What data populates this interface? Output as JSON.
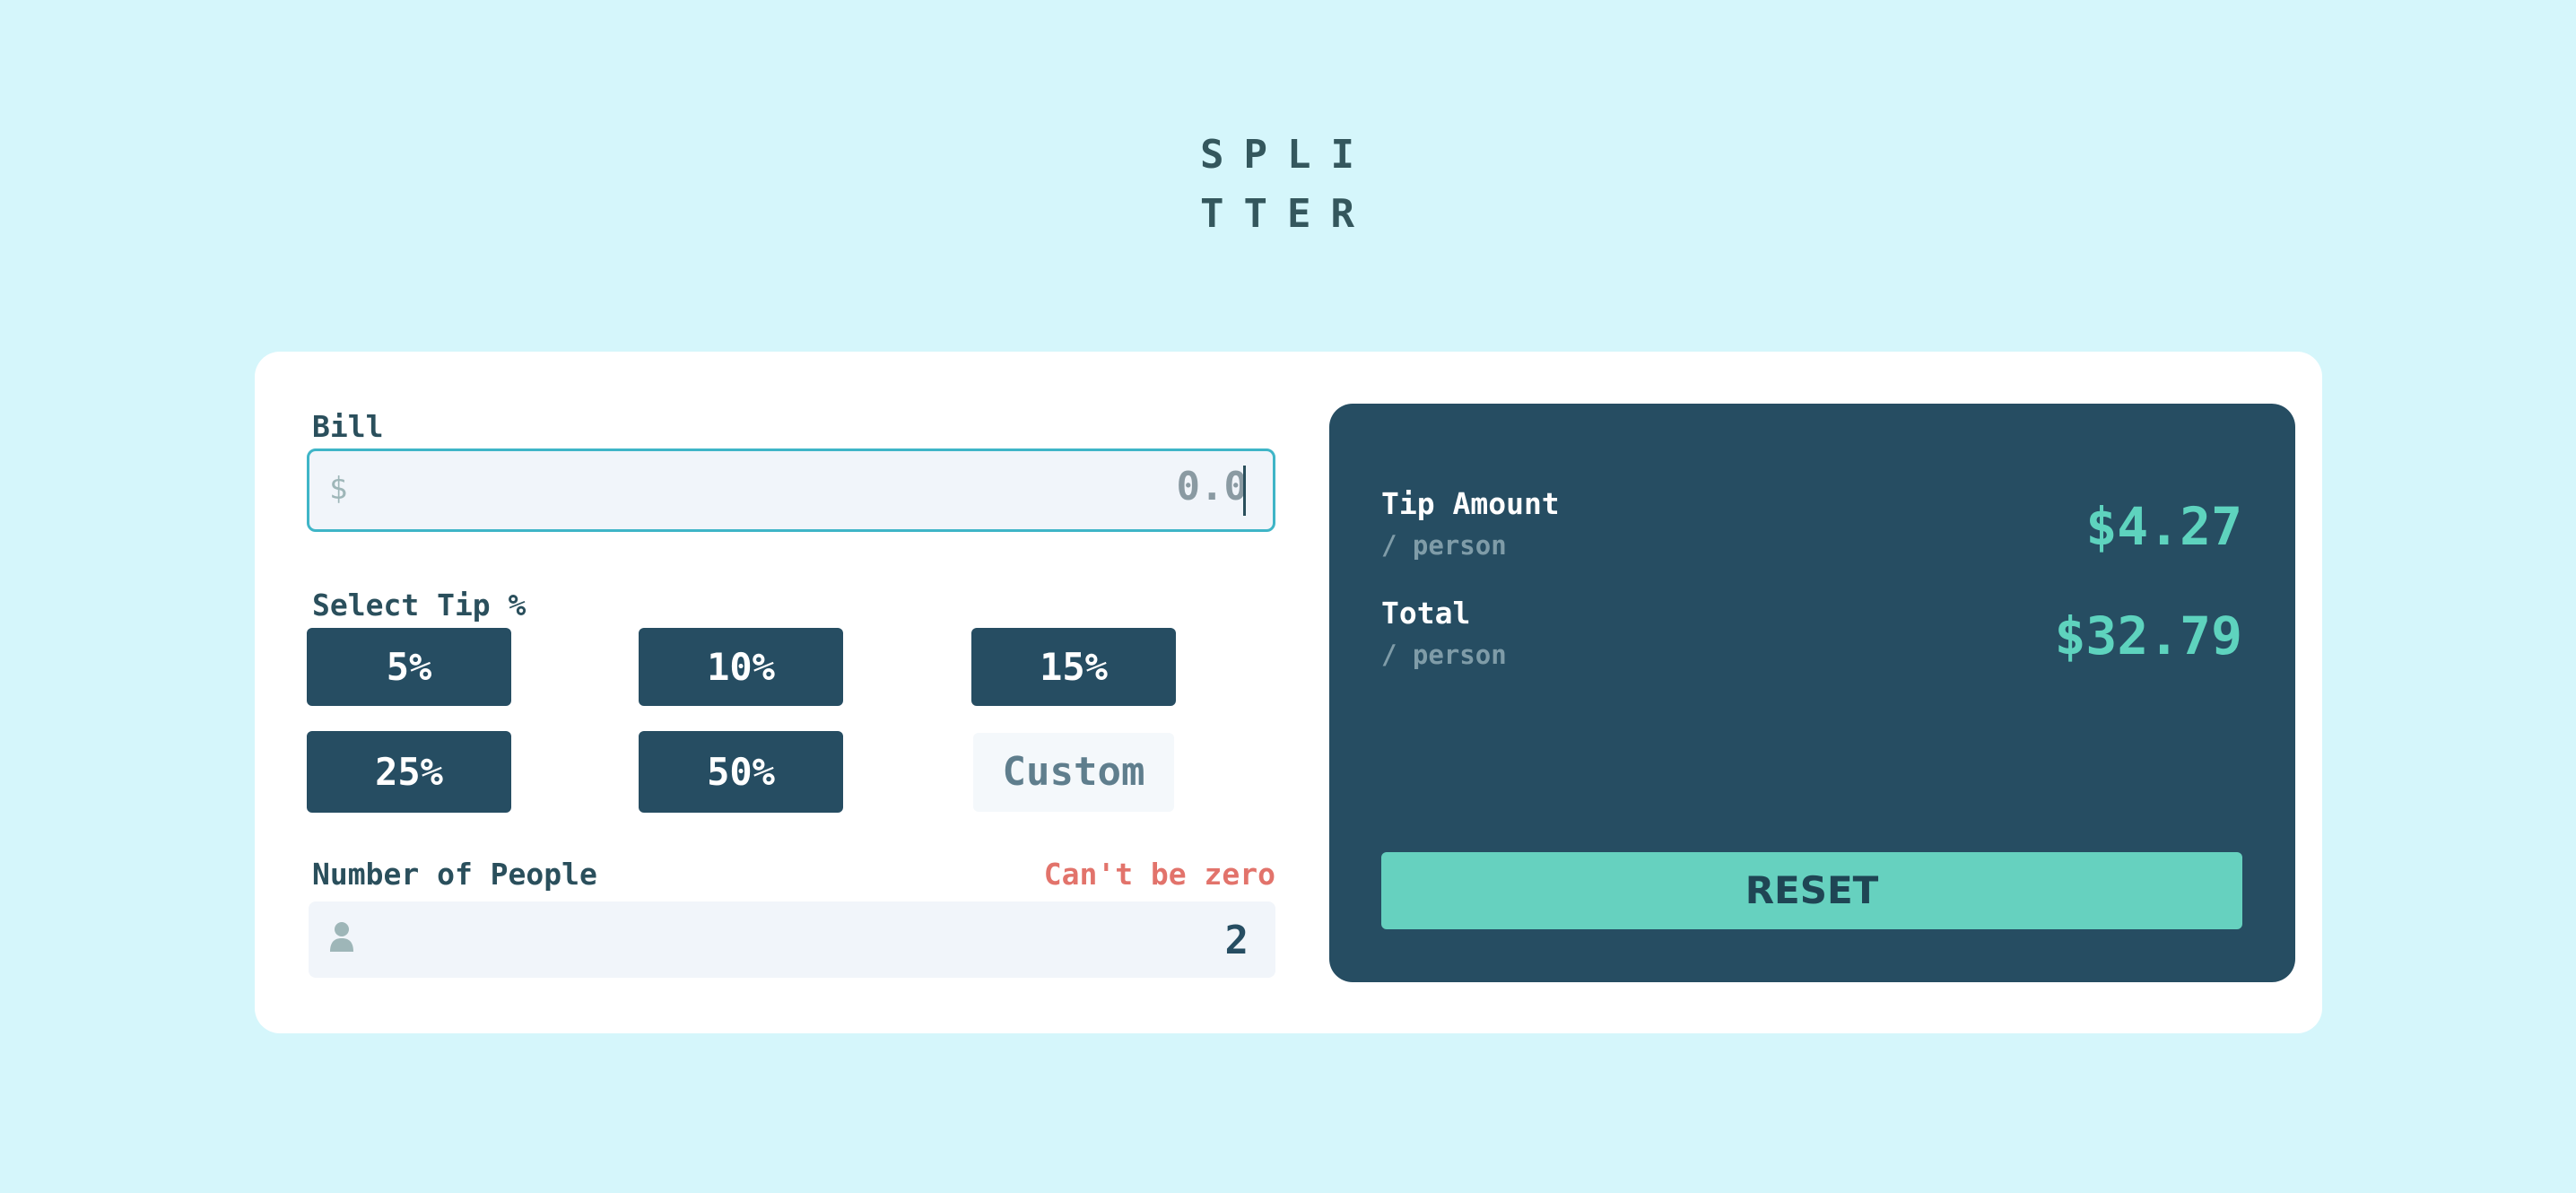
{
  "logo": {
    "line1": "SPLI",
    "line2": "TTER"
  },
  "bill": {
    "label": "Bill",
    "currency_symbol": "$",
    "value": "0.0"
  },
  "tip": {
    "label": "Select Tip %",
    "options": [
      "5%",
      "10%",
      "15%",
      "25%",
      "50%"
    ],
    "custom_placeholder": "Custom"
  },
  "people": {
    "label": "Number of People",
    "error": "Can't be zero",
    "value": "2"
  },
  "results": {
    "tip_amount": {
      "title": "Tip Amount",
      "sub": "/ person",
      "value": "$4.27"
    },
    "total": {
      "title": "Total",
      "sub": "/ person",
      "value": "$32.79"
    },
    "reset_label": "RESET"
  },
  "colors": {
    "background": "#d5f6fb",
    "panel": "#264d62",
    "accent": "#5ed3be",
    "error": "#e2736b",
    "input_focus_border": "#3fb5c7"
  },
  "icons": {
    "bill": "dollar-icon",
    "people": "person-icon"
  }
}
